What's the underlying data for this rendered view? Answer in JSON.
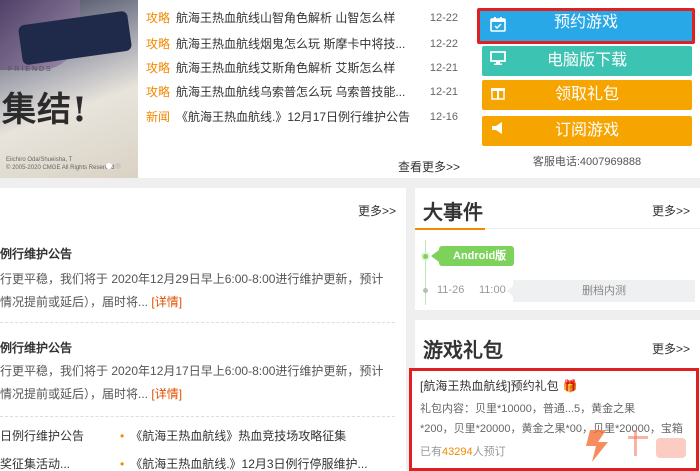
{
  "banner": {
    "slogan": "集结!",
    "friends": "FRIENDS",
    "copyright_1": "Eiichiro Oda/Shueisha, T",
    "copyright_2": "© 2005-2020 CMGE All Rights Reserved"
  },
  "news": {
    "items": [
      {
        "category": "攻略",
        "title": "航海王热血航线山智角色解析 山智怎么样",
        "date": "12-22"
      },
      {
        "category": "攻略",
        "title": "航海王热血航线烟鬼怎么玩 斯摩卡中将技...",
        "date": "12-22"
      },
      {
        "category": "攻略",
        "title": "航海王热血航线艾斯角色解析 艾斯怎么样",
        "date": "12-21"
      },
      {
        "category": "攻略",
        "title": "航海王热血航线乌索普怎么玩 乌索普技能...",
        "date": "12-21"
      },
      {
        "category": "新闻",
        "title": "《航海王热血航线.》12月17日例行维护公告",
        "date": "12-16"
      }
    ],
    "more": "查看更多>>"
  },
  "actions": {
    "book": "预约游戏",
    "pc": "电脑版下载",
    "gift": "领取礼包",
    "subscribe": "订阅游戏",
    "phone": "客服电话:4007969888"
  },
  "announcements": {
    "more": "更多>>",
    "sections": [
      {
        "title": "例行维护公告",
        "line1": "行更平稳，我们将于 2020年12月29日早上6:00-8:00进行维护更新，预计",
        "line2": "情况提前或延后），届时将...",
        "detail": "[详情]"
      },
      {
        "title": "例行维护公告",
        "line1": "行更平稳，我们将于 2020年12月17日早上6:00-8:00进行维护更新，预计",
        "line2": "情况提前或延后），届时将...",
        "detail": "[详情]"
      }
    ],
    "links": [
      {
        "left": "日例行维护公告",
        "right": "《航海王热血航线》热血竞技场攻略征集"
      },
      {
        "left": "奖征集活动...",
        "right": "《航海王热血航线.》12月3日例行停服维护..."
      }
    ]
  },
  "events": {
    "title": "大事件",
    "more": "更多>>",
    "tag": "Android版",
    "date": "11-26",
    "time": "11:00",
    "status": "删档内测"
  },
  "gifts": {
    "title": "游戏礼包",
    "more": "更多>>",
    "pack_title": "[航海王热血航线]预约礼包",
    "content_1": "礼包内容：贝里*10000，普通...5，黄金之果",
    "content_2": "*200，贝里*20000，黄金之果*00，贝里*20000，宝箱",
    "count_prefix": "已有",
    "count": "43294",
    "count_suffix": "人预订"
  },
  "colors": {
    "orange": "#f08a00",
    "blue": "#29a8e7",
    "teal": "#3cc3b2",
    "amber": "#f6a400",
    "red_highlight": "#e02020",
    "green": "#7cd25a"
  }
}
